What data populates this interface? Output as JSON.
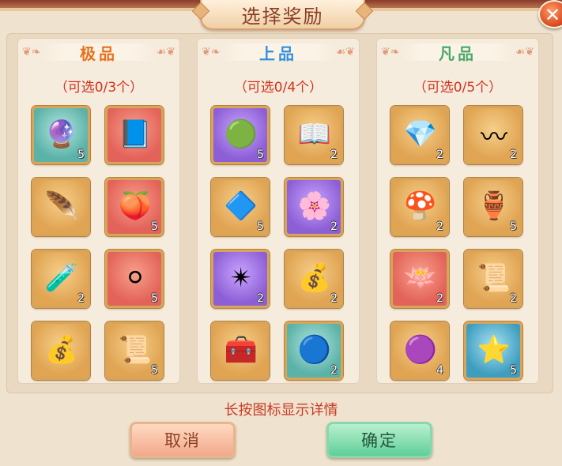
{
  "title": "选择奖励",
  "close_glyph": "✕",
  "columns": [
    {
      "title": "极品",
      "title_color": "#e8711c",
      "count_text": "（可选0/3个）",
      "items": [
        {
          "icon": "ornate-orb-icon",
          "glyph": "🔮",
          "frame": "teal",
          "qty": "5"
        },
        {
          "icon": "book-icon",
          "glyph": "📘",
          "frame": "red",
          "qty": ""
        },
        {
          "icon": "feather-charm-icon",
          "glyph": "🪶",
          "frame": "gold",
          "qty": ""
        },
        {
          "icon": "fruit-icon",
          "glyph": "🍑",
          "frame": "red",
          "qty": "5"
        },
        {
          "icon": "potion-bottle-icon",
          "glyph": "🧪",
          "frame": "gold",
          "qty": "2"
        },
        {
          "icon": "pearl-ring-icon",
          "glyph": "⚪",
          "frame": "red",
          "qty": "5"
        },
        {
          "icon": "treasure-bag-icon",
          "glyph": "💰",
          "frame": "gold",
          "qty": ""
        },
        {
          "icon": "scroll-icon",
          "glyph": "📜",
          "frame": "gold",
          "qty": "5"
        }
      ]
    },
    {
      "title": "上品",
      "title_color": "#2f8fe0",
      "count_text": "（可选0/4个）",
      "items": [
        {
          "icon": "green-orb-icon",
          "glyph": "🟢",
          "frame": "purple",
          "qty": "5"
        },
        {
          "icon": "open-book-icon",
          "glyph": "📖",
          "frame": "gold",
          "qty": "2"
        },
        {
          "icon": "blue-gem-icon",
          "glyph": "🔷",
          "frame": "gold",
          "qty": "5"
        },
        {
          "icon": "white-flower-icon",
          "glyph": "🌸",
          "frame": "purple",
          "qty": "2"
        },
        {
          "icon": "crystal-star-icon",
          "glyph": "✴",
          "frame": "purple",
          "qty": "2"
        },
        {
          "icon": "treasure-bag-icon",
          "glyph": "💰",
          "frame": "gold",
          "qty": "2"
        },
        {
          "icon": "chest-icon",
          "glyph": "🧰",
          "frame": "gold",
          "qty": ""
        },
        {
          "icon": "water-orb-icon",
          "glyph": "🔵",
          "frame": "teal",
          "qty": "2"
        }
      ]
    },
    {
      "title": "凡品",
      "title_color": "#4aa86a",
      "count_text": "（可选0/5个）",
      "items": [
        {
          "icon": "crystal-shard-icon",
          "glyph": "💎",
          "frame": "gold",
          "qty": "2"
        },
        {
          "icon": "golden-wind-icon",
          "glyph": "〰",
          "frame": "gold",
          "qty": "2"
        },
        {
          "icon": "mushroom-icon",
          "glyph": "🍄",
          "frame": "gold",
          "qty": "2"
        },
        {
          "icon": "treasure-pile-icon",
          "glyph": "🏺",
          "frame": "gold",
          "qty": "5"
        },
        {
          "icon": "lotus-orb-icon",
          "glyph": "🪷",
          "frame": "red",
          "qty": "2"
        },
        {
          "icon": "scroll-icon",
          "glyph": "📜",
          "frame": "gold",
          "qty": "2"
        },
        {
          "icon": "purple-orb-icon",
          "glyph": "🟣",
          "frame": "gold",
          "qty": "4"
        },
        {
          "icon": "star-icon",
          "glyph": "⭐",
          "frame": "blue",
          "qty": "5"
        }
      ]
    }
  ],
  "hint": "长按图标显示详情",
  "buttons": {
    "cancel": "取消",
    "confirm": "确定"
  }
}
